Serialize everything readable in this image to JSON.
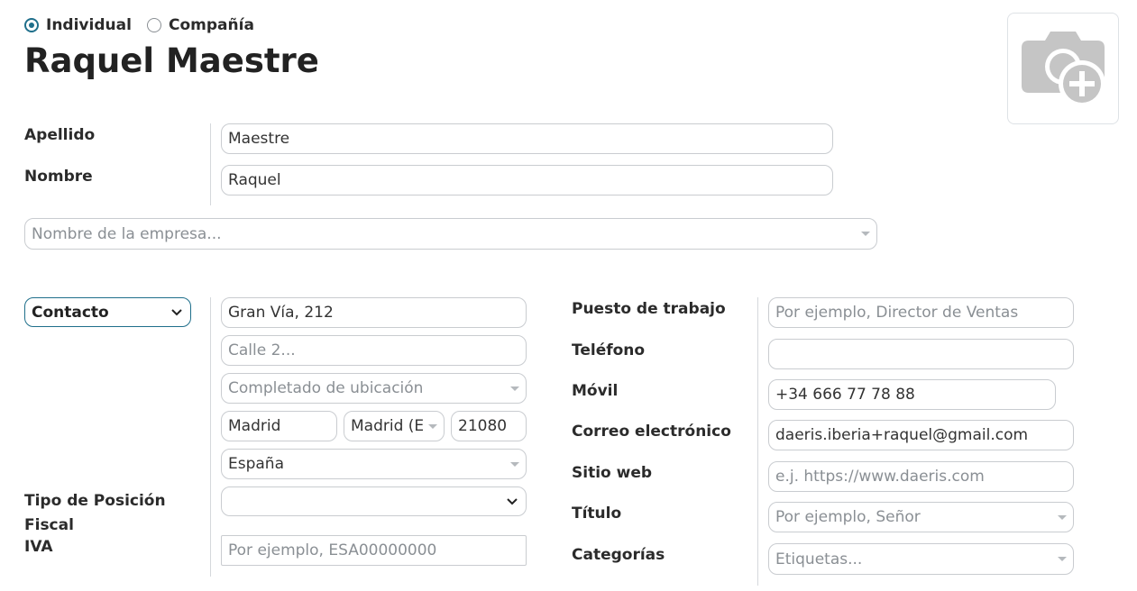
{
  "company_type": {
    "individual_label": "Individual",
    "company_label": "Compañía",
    "selected": "individual"
  },
  "partner_name": "Raquel Maestre",
  "photo": {
    "icon": "camera-plus-icon"
  },
  "fields": {
    "apellido": {
      "label": "Apellido",
      "value": "Maestre"
    },
    "nombre": {
      "label": "Nombre",
      "value": "Raquel"
    },
    "empresa": {
      "placeholder": "Nombre de la empresa..."
    }
  },
  "address_type": {
    "value": "Contacto"
  },
  "address": {
    "street": "Gran Vía, 212",
    "street2_placeholder": "Calle 2...",
    "location_placeholder": "Completado de ubicación",
    "city": "Madrid",
    "state": "Madrid (E",
    "zip": "21080",
    "country": "España"
  },
  "fiscal": {
    "position_label": "Tipo de Posición Fiscal",
    "position_value": "",
    "vat_label": "IVA",
    "vat_placeholder": "Por ejemplo, ESA00000000"
  },
  "contact": {
    "job_label": "Puesto de trabajo",
    "job_placeholder": "Por ejemplo, Director de Ventas",
    "phone_label": "Teléfono",
    "phone_value": "",
    "mobile_label": "Móvil",
    "mobile_value": "+34 666 77 78 88",
    "email_label": "Correo electrónico",
    "email_value": "daeris.iberia+raquel@gmail.com",
    "website_label": "Sitio web",
    "website_placeholder": "e.j. https://www.daeris.com",
    "title_label": "Título",
    "title_placeholder": "Por ejemplo, Señor",
    "tags_label": "Categorías",
    "tags_placeholder": "Etiquetas..."
  }
}
